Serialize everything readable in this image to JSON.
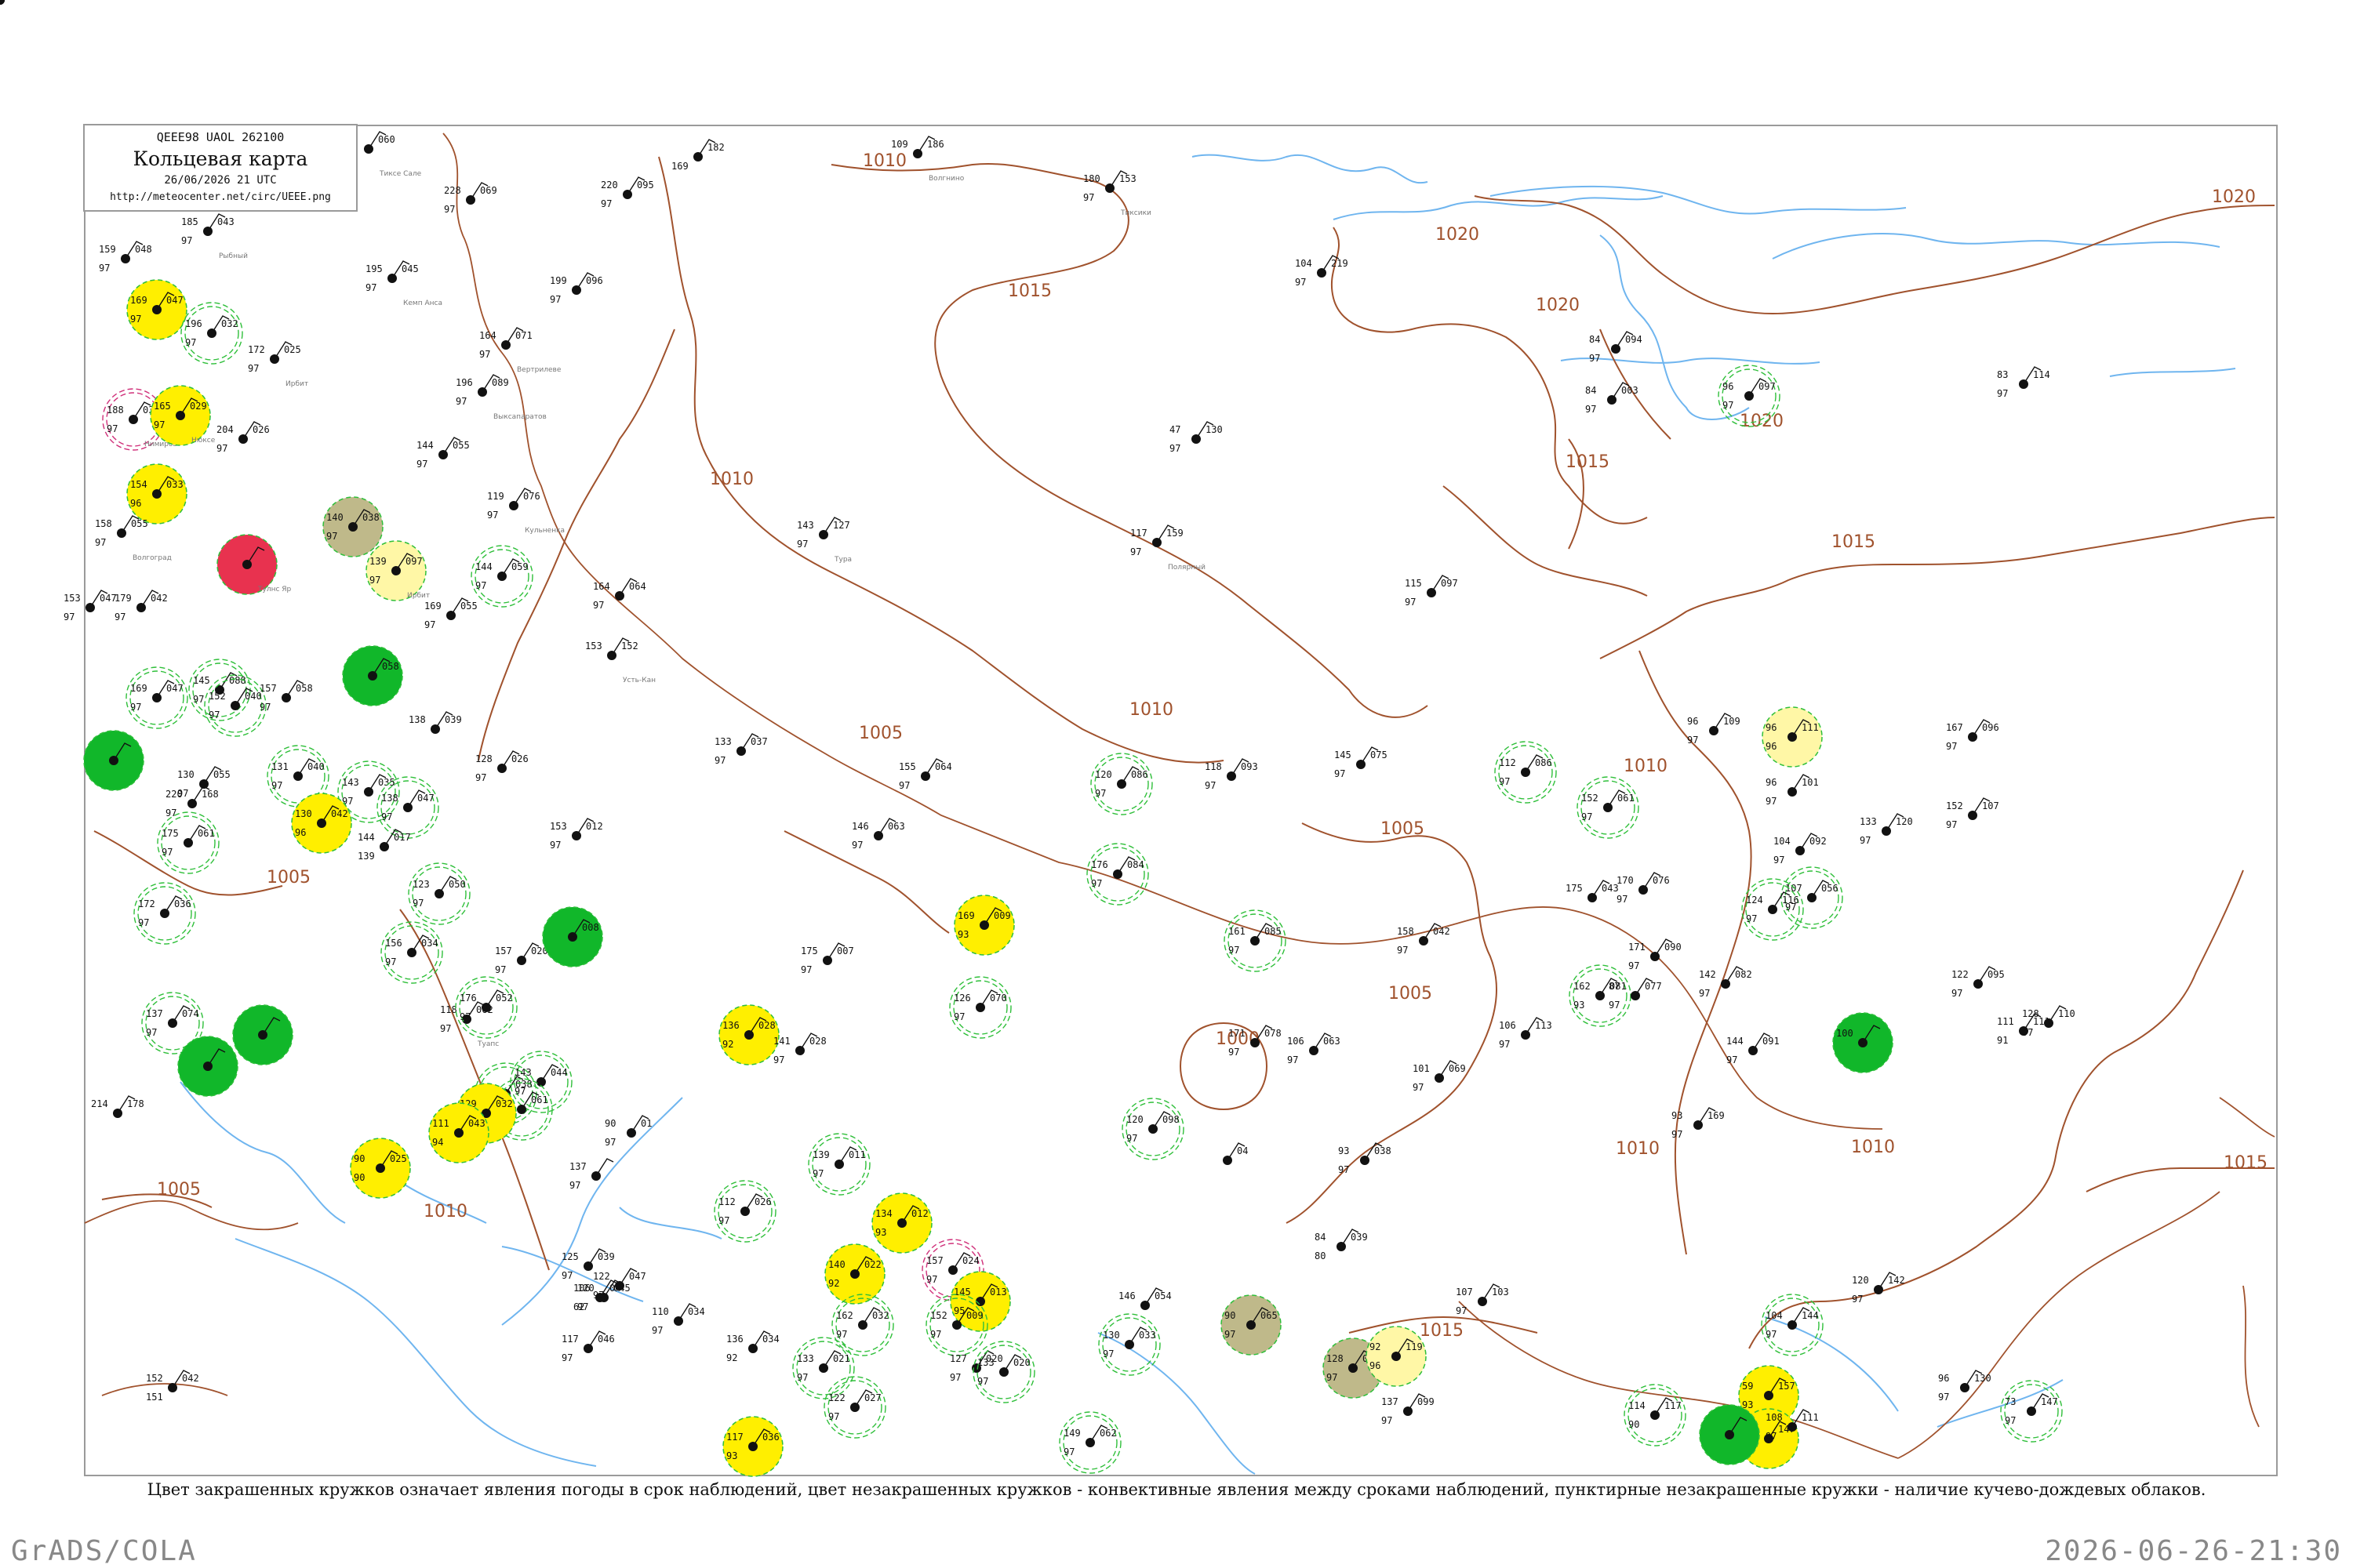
{
  "header": {
    "code_line": "QEEE98  UAOL  262100",
    "title": "Кольцевая карта",
    "date_line": "26/06/2026 21 UTC",
    "url": "http://meteocenter.net/circ/UEEE.png"
  },
  "caption": "Цвет закрашенных кружков означает явления погоды в срок наблюдений, цвет незакрашенных кружков - конвективные явления между сроками наблюдений, пунктирные незакрашенные кружки - наличие кучево-дождевых облаков.",
  "footer": {
    "left": "GrADS/COLA",
    "right": "2026-06-26-21:30"
  },
  "colors": {
    "isobar": "#a0522d",
    "water": "#6fb5ef",
    "green_fill": "#11b72a",
    "yellow_fill": "#ffef00",
    "olive_fill": "#bfb98a",
    "red_fill": "#e8324f",
    "pale_yellow_fill": "#fff7a6",
    "dashed_green": "#2fbf3a",
    "magenta": "#d0307a"
  },
  "isobar_labels": [
    {
      "text": "1010"
    },
    {
      "text": "1015"
    },
    {
      "text": "1020"
    },
    {
      "text": "1020"
    },
    {
      "text": "1020"
    },
    {
      "text": "1020"
    },
    {
      "text": "1015"
    },
    {
      "text": "1010"
    },
    {
      "text": "1015"
    },
    {
      "text": "1005"
    },
    {
      "text": "1010"
    },
    {
      "text": "1005"
    },
    {
      "text": "1010"
    },
    {
      "text": "1005"
    },
    {
      "text": "1000"
    },
    {
      "text": "1005"
    },
    {
      "text": "1005"
    },
    {
      "text": "1010"
    },
    {
      "text": "1015"
    },
    {
      "text": "1010"
    },
    {
      "text": "1015"
    },
    {
      "text": "1010"
    }
  ],
  "stations": [
    {
      "p": "060",
      "t": "",
      "dp": "",
      "name": "Тиксе Сале",
      "kind": "plain"
    },
    {
      "p": "182",
      "t": "",
      "dp": "169",
      "name": "",
      "kind": "plain"
    },
    {
      "p": "186",
      "t": "109",
      "dp": "",
      "name": "Волгнино",
      "kind": "plain"
    },
    {
      "p": "153",
      "t": "180",
      "dp": "97",
      "name": "Тиксики",
      "kind": "plain"
    },
    {
      "p": "095",
      "t": "220",
      "dp": "97",
      "name": "",
      "kind": "plain"
    },
    {
      "p": "069",
      "t": "228",
      "dp": "97",
      "name": "",
      "kind": "plain"
    },
    {
      "p": "043",
      "t": "185",
      "dp": "97",
      "name": "Рыбный",
      "kind": "plain"
    },
    {
      "p": "048",
      "t": "159",
      "dp": "97",
      "name": "",
      "kind": "plain"
    },
    {
      "p": "045",
      "t": "195",
      "dp": "97",
      "name": "Кемп Анса",
      "kind": "plain"
    },
    {
      "p": "096",
      "t": "199",
      "dp": "97",
      "name": "",
      "kind": "plain"
    },
    {
      "p": "047",
      "t": "169",
      "dp": "97",
      "name": "",
      "kind": "yellow"
    },
    {
      "p": "032",
      "t": "196",
      "dp": "97",
      "name": "",
      "kind": "dashed"
    },
    {
      "p": "025",
      "t": "172",
      "dp": "97",
      "name": "Ирбит",
      "kind": "plain"
    },
    {
      "p": "071",
      "t": "164",
      "dp": "97",
      "name": "Вертрилеве",
      "kind": "plain"
    },
    {
      "p": "219",
      "t": "104",
      "dp": "97",
      "name": "",
      "kind": "plain"
    },
    {
      "p": "030",
      "t": "188",
      "dp": "97",
      "name": "Нимиров",
      "kind": "magenta"
    },
    {
      "p": "029",
      "t": "165",
      "dp": "97",
      "name": "Нюксе",
      "kind": "yellow"
    },
    {
      "p": "026",
      "t": "204",
      "dp": "97",
      "name": "",
      "kind": "plain"
    },
    {
      "p": "089",
      "t": "196",
      "dp": "97",
      "name": "Выксапаратов",
      "kind": "plain"
    },
    {
      "p": "055",
      "t": "144",
      "dp": "97",
      "name": "",
      "kind": "plain"
    },
    {
      "p": "033",
      "t": "154",
      "dp": "96",
      "name": "",
      "kind": "yellow"
    },
    {
      "p": "076",
      "t": "119",
      "dp": "97",
      "name": "Кульненка",
      "kind": "plain"
    },
    {
      "p": "038",
      "t": "140",
      "dp": "97",
      "name": "",
      "kind": "olive"
    },
    {
      "p": "055",
      "t": "158",
      "dp": "97",
      "name": "Волгоград",
      "kind": "plain"
    },
    {
      "p": "097",
      "t": "139",
      "dp": "97",
      "name": "Ирбит",
      "kind": "pale_yellow"
    },
    {
      "p": "",
      "t": "",
      "dp": "",
      "name": "Тулнс Яр",
      "kind": "red"
    },
    {
      "p": "059",
      "t": "144",
      "dp": "97",
      "name": "",
      "kind": "dashed"
    },
    {
      "p": "064",
      "t": "164",
      "dp": "97",
      "name": "",
      "kind": "plain"
    },
    {
      "p": "127",
      "t": "143",
      "dp": "97",
      "name": "Тура",
      "kind": "plain"
    },
    {
      "p": "159",
      "t": "117",
      "dp": "97",
      "name": "Полярный",
      "kind": "plain"
    },
    {
      "p": "097",
      "t": "115",
      "dp": "97",
      "name": "",
      "kind": "plain"
    },
    {
      "p": "055",
      "t": "169",
      "dp": "97",
      "name": "",
      "kind": "plain"
    },
    {
      "p": "042",
      "t": "179",
      "dp": "97",
      "name": "",
      "kind": "plain"
    },
    {
      "p": "047",
      "t": "153",
      "dp": "97",
      "name": "",
      "kind": "plain"
    },
    {
      "p": "047",
      "t": "169",
      "dp": "97",
      "name": "",
      "kind": "dashed"
    },
    {
      "p": "058",
      "t": "",
      "dp": "",
      "name": "",
      "kind": "green"
    },
    {
      "p": "152",
      "t": "153",
      "dp": "",
      "name": "Усть-Кан",
      "kind": "plain"
    },
    {
      "p": "088",
      "t": "145",
      "dp": "97",
      "name": "",
      "kind": "dashed"
    },
    {
      "p": "040",
      "t": "152",
      "dp": "97",
      "name": "",
      "kind": "dashed"
    },
    {
      "p": "058",
      "t": "157",
      "dp": "97",
      "name": "",
      "kind": "plain"
    },
    {
      "p": "",
      "t": "",
      "dp": "",
      "name": "",
      "kind": "green"
    },
    {
      "p": "037",
      "t": "133",
      "dp": "97",
      "name": "",
      "kind": "plain"
    },
    {
      "p": "039",
      "t": "138",
      "dp": "",
      "name": "",
      "kind": "plain"
    },
    {
      "p": "026",
      "t": "128",
      "dp": "97",
      "name": "",
      "kind": "plain"
    },
    {
      "p": "064",
      "t": "155",
      "dp": "97",
      "name": "",
      "kind": "plain"
    },
    {
      "p": "055",
      "t": "130",
      "dp": "97",
      "name": "",
      "kind": "plain"
    },
    {
      "p": "168",
      "t": "220",
      "dp": "97",
      "name": "",
      "kind": "plain"
    },
    {
      "p": "040",
      "t": "131",
      "dp": "97",
      "name": "",
      "kind": "dashed"
    },
    {
      "p": "035",
      "t": "143",
      "dp": "97",
      "name": "",
      "kind": "dashed"
    },
    {
      "p": "047",
      "t": "138",
      "dp": "97",
      "name": "",
      "kind": "dashed"
    },
    {
      "p": "042",
      "t": "130",
      "dp": "96",
      "name": "",
      "kind": "yellow"
    },
    {
      "p": "017",
      "t": "144",
      "dp": "139",
      "name": "",
      "kind": "plain"
    },
    {
      "p": "012",
      "t": "153",
      "dp": "97",
      "name": "",
      "kind": "plain"
    },
    {
      "p": "063",
      "t": "146",
      "dp": "97",
      "name": "",
      "kind": "plain"
    },
    {
      "p": "061",
      "t": "175",
      "dp": "97",
      "name": "",
      "kind": "dashed"
    },
    {
      "p": "036",
      "t": "172",
      "dp": "97",
      "name": "",
      "kind": "dashed"
    },
    {
      "p": "050",
      "t": "123",
      "dp": "97",
      "name": "",
      "kind": "dashed"
    },
    {
      "p": "034",
      "t": "156",
      "dp": "97",
      "name": "",
      "kind": "dashed"
    },
    {
      "p": "020",
      "t": "157",
      "dp": "97",
      "name": "",
      "kind": "plain"
    },
    {
      "p": "008",
      "t": "",
      "dp": "",
      "name": "",
      "kind": "green"
    },
    {
      "p": "007",
      "t": "175",
      "dp": "97",
      "name": "",
      "kind": "plain"
    },
    {
      "p": "009",
      "t": "169",
      "dp": "93",
      "name": "",
      "kind": "yellow"
    },
    {
      "p": "070",
      "t": "126",
      "dp": "97",
      "name": "",
      "kind": "dashed"
    },
    {
      "p": "062",
      "t": "118",
      "dp": "97",
      "name": "Туапс",
      "kind": "plain"
    },
    {
      "p": "052",
      "t": "176",
      "dp": "97",
      "name": "",
      "kind": "dashed"
    },
    {
      "p": "074",
      "t": "137",
      "dp": "97",
      "name": "",
      "kind": "dashed"
    },
    {
      "p": "",
      "t": "",
      "dp": "",
      "name": "",
      "kind": "green"
    },
    {
      "p": "",
      "t": "",
      "dp": "",
      "name": "",
      "kind": "green"
    },
    {
      "p": "028",
      "t": "136",
      "dp": "92",
      "name": "",
      "kind": "yellow"
    },
    {
      "p": "028",
      "t": "141",
      "dp": "97",
      "name": "",
      "kind": "plain"
    },
    {
      "p": "044",
      "t": "143",
      "dp": "97",
      "name": "",
      "kind": "dashed"
    },
    {
      "p": "038",
      "t": "",
      "dp": "",
      "name": "",
      "kind": "dashed"
    },
    {
      "p": "061",
      "t": "111",
      "dp": "97",
      "name": "",
      "kind": "dashed"
    },
    {
      "p": "032",
      "t": "129",
      "dp": "93",
      "name": "",
      "kind": "yellow"
    },
    {
      "p": "043",
      "t": "111",
      "dp": "94",
      "name": "",
      "kind": "yellow"
    },
    {
      "p": "01",
      "t": "90",
      "dp": "97",
      "name": "",
      "kind": "plain"
    },
    {
      "p": "",
      "t": "137",
      "dp": "97",
      "name": "",
      "kind": "plain"
    },
    {
      "p": "025",
      "t": "90",
      "dp": "90",
      "name": "",
      "kind": "yellow"
    },
    {
      "p": "178",
      "t": "214",
      "dp": "",
      "name": "",
      "kind": "plain"
    },
    {
      "p": "026",
      "t": "112",
      "dp": "97",
      "name": "",
      "kind": "dashed"
    },
    {
      "p": "011",
      "t": "139",
      "dp": "97",
      "name": "",
      "kind": "dashed"
    },
    {
      "p": "012",
      "t": "134",
      "dp": "93",
      "name": "",
      "kind": "yellow"
    },
    {
      "p": "024",
      "t": "157",
      "dp": "97",
      "name": "",
      "kind": "magenta"
    },
    {
      "p": "022",
      "t": "140",
      "dp": "92",
      "name": "",
      "kind": "yellow"
    },
    {
      "p": "013",
      "t": "145",
      "dp": "95",
      "name": "",
      "kind": "yellow"
    },
    {
      "p": "009",
      "t": "152",
      "dp": "97",
      "name": "",
      "kind": "dashed"
    },
    {
      "p": "032",
      "t": "162",
      "dp": "97",
      "name": "",
      "kind": "dashed"
    },
    {
      "p": "020",
      "t": "127",
      "dp": "97",
      "name": "",
      "kind": "plain"
    },
    {
      "p": "020",
      "t": "133",
      "dp": "97",
      "name": "",
      "kind": "dashed"
    },
    {
      "p": "021",
      "t": "133",
      "dp": "97",
      "name": "",
      "kind": "dashed"
    },
    {
      "p": "027",
      "t": "122",
      "dp": "97",
      "name": "",
      "kind": "dashed"
    },
    {
      "p": "036",
      "t": "117",
      "dp": "93",
      "name": "",
      "kind": "yellow"
    },
    {
      "p": "034",
      "t": "110",
      "dp": "97",
      "name": "",
      "kind": "plain"
    },
    {
      "p": "034",
      "t": "136",
      "dp": "92",
      "name": "",
      "kind": "plain"
    },
    {
      "p": "046",
      "t": "117",
      "dp": "97",
      "name": "",
      "kind": "plain"
    },
    {
      "p": "047",
      "t": "122",
      "dp": "97",
      "name": "",
      "kind": "plain"
    },
    {
      "p": "039",
      "t": "125",
      "dp": "97",
      "name": "",
      "kind": "plain"
    },
    {
      "p": "045",
      "t": "120",
      "dp": "97",
      "name": "",
      "kind": "plain"
    },
    {
      "p": "04",
      "t": "106",
      "dp": "62",
      "name": "",
      "kind": "plain"
    },
    {
      "p": "042",
      "t": "152",
      "dp": "151",
      "name": "",
      "kind": "plain"
    },
    {
      "p": "062",
      "t": "149",
      "dp": "97",
      "name": "",
      "kind": "dashed"
    },
    {
      "p": "054",
      "t": "146",
      "dp": "",
      "name": "",
      "kind": "plain"
    },
    {
      "p": "033",
      "t": "130",
      "dp": "97",
      "name": "",
      "kind": "dashed"
    },
    {
      "p": "098",
      "t": "120",
      "dp": "97",
      "name": "",
      "kind": "dashed"
    },
    {
      "p": "084",
      "t": "176",
      "dp": "97",
      "name": "",
      "kind": "dashed"
    },
    {
      "p": "086",
      "t": "120",
      "dp": "97",
      "name": "",
      "kind": "dashed"
    },
    {
      "p": "093",
      "t": "118",
      "dp": "97",
      "name": "",
      "kind": "plain"
    },
    {
      "p": "075",
      "t": "145",
      "dp": "97",
      "name": "",
      "kind": "plain"
    },
    {
      "p": "086",
      "t": "112",
      "dp": "97",
      "name": "",
      "kind": "dashed"
    },
    {
      "p": "061",
      "t": "152",
      "dp": "97",
      "name": "",
      "kind": "dashed"
    },
    {
      "p": "085",
      "t": "161",
      "dp": "97",
      "name": "",
      "kind": "dashed"
    },
    {
      "p": "042",
      "t": "158",
      "dp": "97",
      "name": "",
      "kind": "plain"
    },
    {
      "p": "043",
      "t": "175",
      "dp": "",
      "name": "",
      "kind": "plain"
    },
    {
      "p": "076",
      "t": "170",
      "dp": "97",
      "name": "",
      "kind": "plain"
    },
    {
      "p": "090",
      "t": "171",
      "dp": "97",
      "name": "",
      "kind": "plain"
    },
    {
      "p": "081",
      "t": "162",
      "dp": "93",
      "name": "",
      "kind": "dashed"
    },
    {
      "p": "077",
      "t": "87",
      "dp": "97",
      "name": "",
      "kind": "plain"
    },
    {
      "p": "082",
      "t": "142",
      "dp": "97",
      "name": "",
      "kind": "plain"
    },
    {
      "p": "091",
      "t": "144",
      "dp": "97",
      "name": "",
      "kind": "plain"
    },
    {
      "p": "113",
      "t": "106",
      "dp": "97",
      "name": "",
      "kind": "plain"
    },
    {
      "p": "069",
      "t": "101",
      "dp": "97",
      "name": "",
      "kind": "plain"
    },
    {
      "p": "063",
      "t": "106",
      "dp": "97",
      "name": "",
      "kind": "plain"
    },
    {
      "p": "078",
      "t": "171",
      "dp": "97",
      "name": "",
      "kind": "plain"
    },
    {
      "p": "04",
      "t": "",
      "dp": "",
      "name": "",
      "kind": "plain"
    },
    {
      "p": "038",
      "t": "93",
      "dp": "97",
      "name": "",
      "kind": "plain"
    },
    {
      "p": "039",
      "t": "84",
      "dp": "80",
      "name": "",
      "kind": "plain"
    },
    {
      "p": "065",
      "t": "90",
      "dp": "97",
      "name": "",
      "kind": "olive"
    },
    {
      "p": "084",
      "t": "128",
      "dp": "97",
      "name": "",
      "kind": "olive"
    },
    {
      "p": "119",
      "t": "92",
      "dp": "96",
      "name": "",
      "kind": "pale_yellow"
    },
    {
      "p": "099",
      "t": "137",
      "dp": "97",
      "name": "",
      "kind": "plain"
    },
    {
      "p": "103",
      "t": "107",
      "dp": "97",
      "name": "",
      "kind": "plain"
    },
    {
      "p": "109",
      "t": "96",
      "dp": "97",
      "name": "",
      "kind": "plain"
    },
    {
      "p": "111",
      "t": "96",
      "dp": "96",
      "name": "",
      "kind": "pale_yellow"
    },
    {
      "p": "101",
      "t": "96",
      "dp": "97",
      "name": "",
      "kind": "plain"
    },
    {
      "p": "092",
      "t": "104",
      "dp": "97",
      "name": "",
      "kind": "plain"
    },
    {
      "p": "056",
      "t": "107",
      "dp": "97",
      "name": "",
      "kind": "dashed"
    },
    {
      "p": "116",
      "t": "124",
      "dp": "97",
      "name": "",
      "kind": "dashed"
    },
    {
      "p": "120",
      "t": "133",
      "dp": "97",
      "name": "",
      "kind": "plain"
    },
    {
      "p": "096",
      "t": "167",
      "dp": "97",
      "name": "",
      "kind": "plain"
    },
    {
      "p": "107",
      "t": "152",
      "dp": "97",
      "name": "",
      "kind": "plain"
    },
    {
      "p": "095",
      "t": "122",
      "dp": "97",
      "name": "",
      "kind": "plain"
    },
    {
      "p": "111",
      "t": "111",
      "dp": "91",
      "name": "",
      "kind": "plain"
    },
    {
      "p": "110",
      "t": "128",
      "dp": "97",
      "name": "",
      "kind": "plain"
    },
    {
      "p": "",
      "t": "100",
      "dp": "",
      "name": "",
      "kind": "green"
    },
    {
      "p": "142",
      "t": "120",
      "dp": "97",
      "name": "",
      "kind": "plain"
    },
    {
      "p": "144",
      "t": "104",
      "dp": "97",
      "name": "",
      "kind": "dashed"
    },
    {
      "p": "157",
      "t": "59",
      "dp": "93",
      "name": "",
      "kind": "yellow"
    },
    {
      "p": "147",
      "t": "85",
      "dp": "93",
      "name": "",
      "kind": "yellow"
    },
    {
      "p": "111",
      "t": "108",
      "dp": "97",
      "name": "",
      "kind": "plain"
    },
    {
      "p": "130",
      "t": "96",
      "dp": "97",
      "name": "",
      "kind": "plain"
    },
    {
      "p": "147",
      "t": "73",
      "dp": "97",
      "name": "",
      "kind": "dashed"
    },
    {
      "p": "",
      "t": "",
      "dp": "",
      "name": "",
      "kind": "green"
    },
    {
      "p": "117",
      "t": "114",
      "dp": "90",
      "name": "",
      "kind": "dashed"
    },
    {
      "p": "097",
      "t": "96",
      "dp": "97",
      "name": "",
      "kind": "dashed"
    },
    {
      "p": "114",
      "t": "83",
      "dp": "97",
      "name": "",
      "kind": "plain"
    },
    {
      "p": "094",
      "t": "84",
      "dp": "97",
      "name": "",
      "kind": "plain"
    },
    {
      "p": "003",
      "t": "84",
      "dp": "97",
      "name": "",
      "kind": "plain"
    },
    {
      "p": "169",
      "t": "93",
      "dp": "97",
      "name": "",
      "kind": "plain"
    },
    {
      "p": "130",
      "t": "47",
      "dp": "97",
      "name": "",
      "kind": "plain"
    },
    {
      "p": "096",
      "t": "76",
      "dp": "97",
      "name": "",
      "kind": "plain"
    },
    {
      "p": "092",
      "t": "111",
      "dp": "97",
      "name": "",
      "kind": "plain"
    },
    {
      "p": "32",
      "t": "114",
      "dp": "",
      "name": "",
      "kind": "plain"
    }
  ]
}
